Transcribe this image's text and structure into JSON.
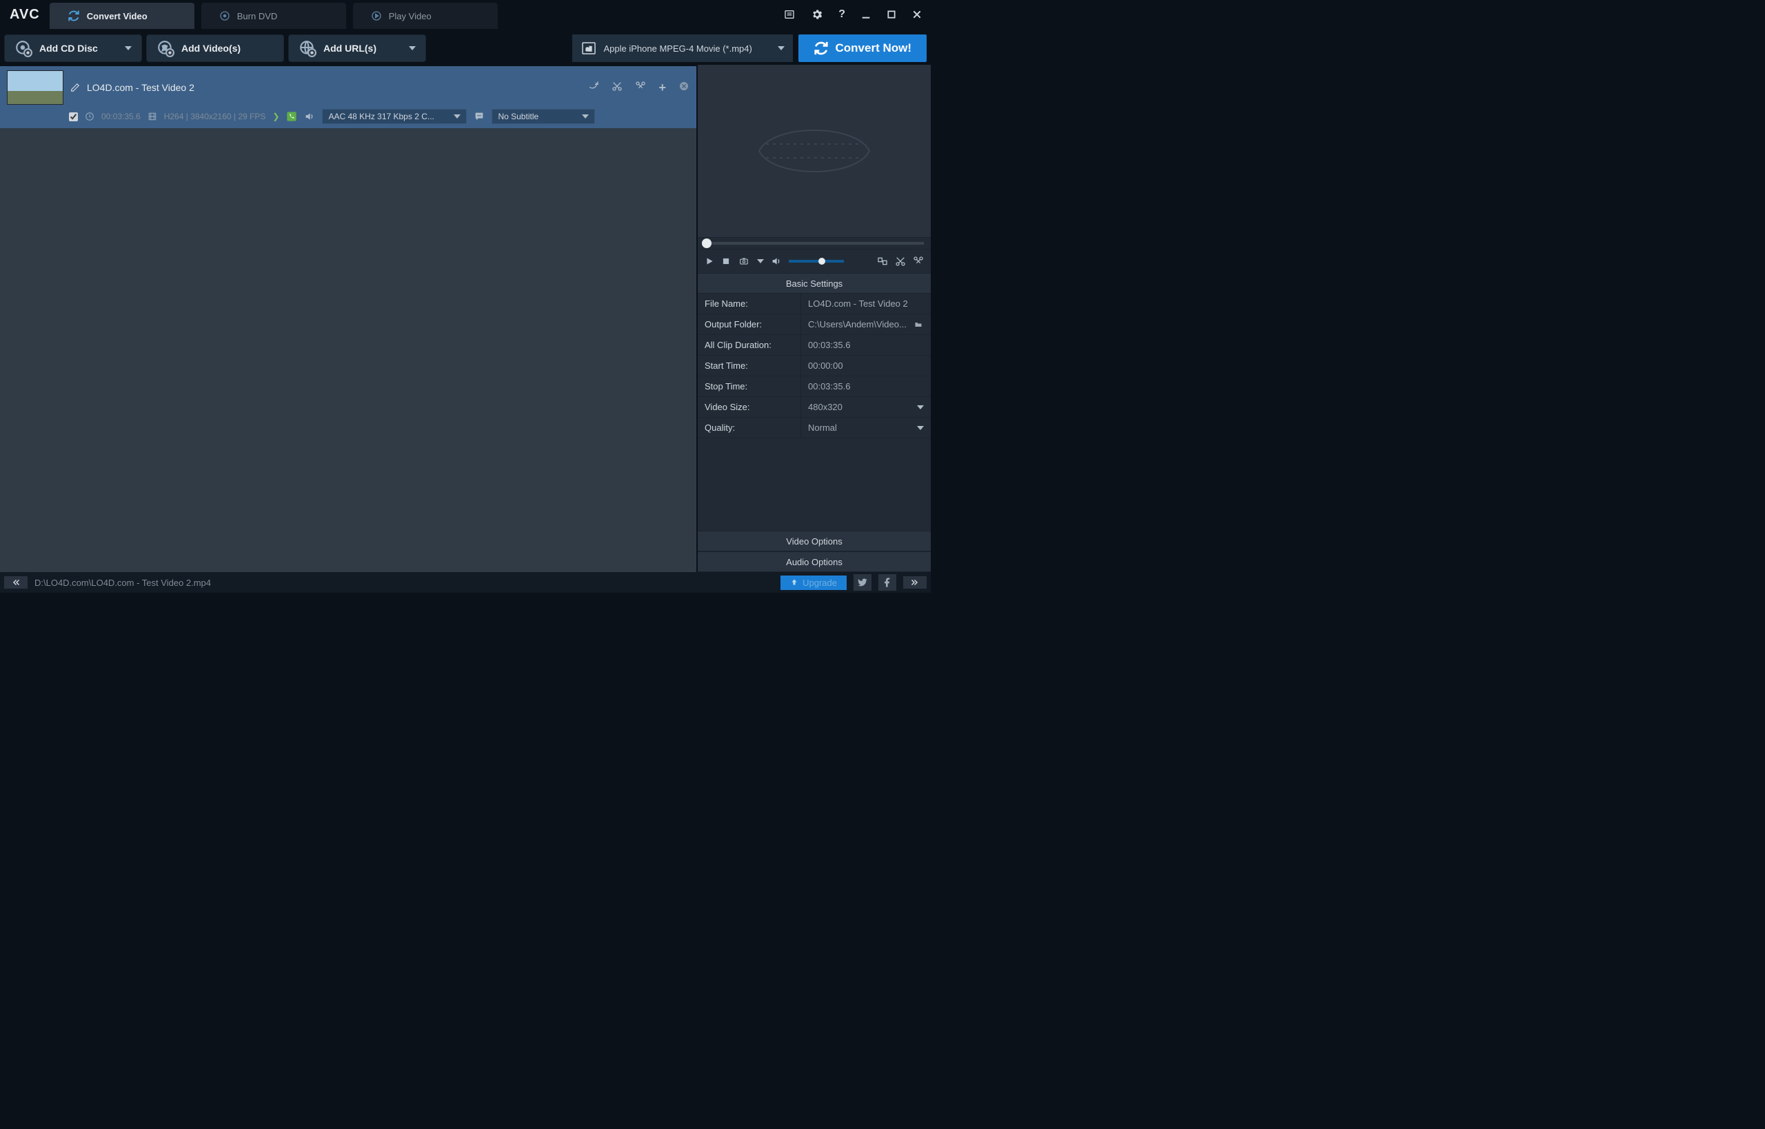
{
  "app": {
    "logo": "AVC"
  },
  "tabs": [
    {
      "label": "Convert Video"
    },
    {
      "label": "Burn DVD"
    },
    {
      "label": "Play Video"
    }
  ],
  "toolbar": {
    "add_cd": "Add CD Disc",
    "add_videos": "Add Video(s)",
    "add_urls": "Add URL(s)",
    "profile": "Apple iPhone MPEG-4 Movie (*.mp4)",
    "convert": "Convert Now!"
  },
  "item": {
    "title": "LO4D.com - Test Video 2",
    "duration": "00:03:35.6",
    "video_info": "H264 | 3840x2160 | 29 FPS",
    "audio": "AAC 48 KHz 317 Kbps 2 C...",
    "subtitle": "No Subtitle"
  },
  "settings": {
    "heading": "Basic Settings",
    "file_name_label": "File Name:",
    "file_name": "LO4D.com - Test Video 2",
    "output_folder_label": "Output Folder:",
    "output_folder": "C:\\Users\\Andem\\Video...",
    "all_clip_label": "All Clip Duration:",
    "all_clip": "00:03:35.6",
    "start_label": "Start Time:",
    "start": "00:00:00",
    "stop_label": "Stop Time:",
    "stop": "00:03:35.6",
    "size_label": "Video Size:",
    "size": "480x320",
    "quality_label": "Quality:",
    "quality": "Normal",
    "video_options": "Video Options",
    "audio_options": "Audio Options"
  },
  "status": {
    "path": "D:\\LO4D.com\\LO4D.com - Test Video 2.mp4",
    "upgrade": "Upgrade"
  }
}
